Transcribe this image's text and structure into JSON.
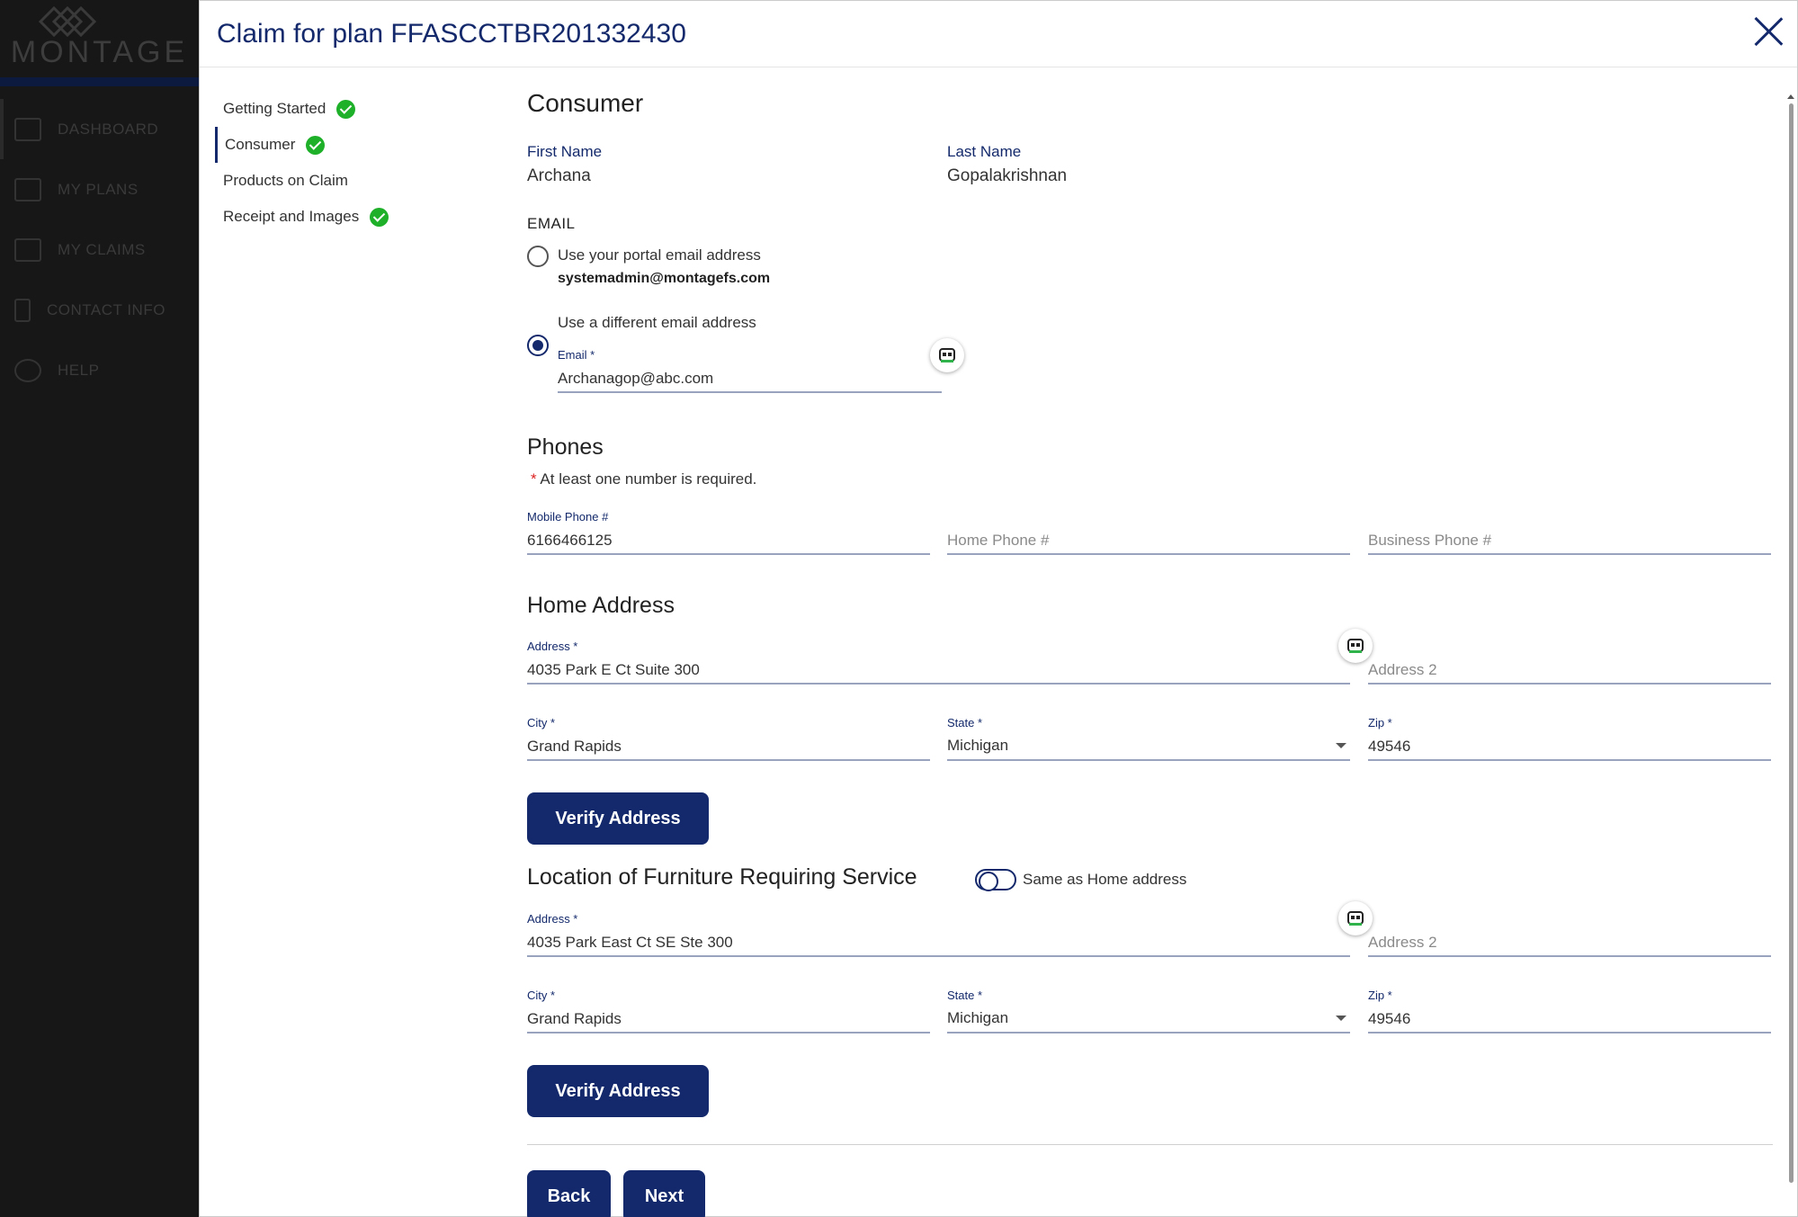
{
  "app": {
    "logo_text": "MONTAGE",
    "nav": [
      {
        "label": "DASHBOARD",
        "icon": "dashboard-icon"
      },
      {
        "label": "MY PLANS",
        "icon": "plans-icon"
      },
      {
        "label": "MY CLAIMS",
        "icon": "claims-icon"
      },
      {
        "label": "CONTACT INFO",
        "icon": "contact-icon"
      },
      {
        "label": "HELP",
        "icon": "help-icon"
      }
    ]
  },
  "modal": {
    "title": "Claim for plan FFASCCTBR201332430",
    "close_icon": "close-icon"
  },
  "steps": [
    {
      "label": "Getting Started",
      "complete": true
    },
    {
      "label": "Consumer",
      "complete": true,
      "active": true
    },
    {
      "label": "Products on Claim",
      "complete": false
    },
    {
      "label": "Receipt and Images",
      "complete": true
    }
  ],
  "consumer": {
    "heading": "Consumer",
    "first_name_label": "First Name",
    "first_name": "Archana",
    "last_name_label": "Last Name",
    "last_name": "Gopalakrishnan"
  },
  "email": {
    "heading": "EMAIL",
    "option_portal": "Use your portal email address",
    "portal_email": "systemadmin@montagefs.com",
    "option_different": "Use a different email address",
    "field_label": "Email *",
    "value": "Archanagop@abc.com",
    "selected": "different"
  },
  "phones": {
    "heading": "Phones",
    "required_star": "*",
    "note": "At least one number is required.",
    "mobile_label": "Mobile Phone #",
    "mobile_value": "6166466125",
    "home_placeholder": "Home Phone #",
    "business_placeholder": "Business Phone #"
  },
  "home_address": {
    "heading": "Home Address",
    "address_label": "Address *",
    "address_value": "4035 Park E Ct Suite 300",
    "address2_placeholder": "Address 2",
    "city_label": "City *",
    "city_value": "Grand Rapids",
    "state_label": "State *",
    "state_value": "Michigan",
    "zip_label": "Zip *",
    "zip_value": "49546",
    "verify_label": "Verify Address"
  },
  "service_location": {
    "heading": "Location of Furniture Requiring Service",
    "same_toggle_label": "Same as Home address",
    "same_toggle_on": false,
    "address_label": "Address *",
    "address_value": "4035 Park East Ct SE Ste 300",
    "address2_placeholder": "Address 2",
    "city_label": "City *",
    "city_value": "Grand Rapids",
    "state_label": "State *",
    "state_value": "Michigan",
    "zip_label": "Zip *",
    "zip_value": "49546",
    "verify_label": "Verify Address"
  },
  "footer": {
    "back_label": "Back",
    "next_label": "Next"
  },
  "colors": {
    "brand_navy": "#13296b",
    "success_green": "#1fb02a"
  }
}
